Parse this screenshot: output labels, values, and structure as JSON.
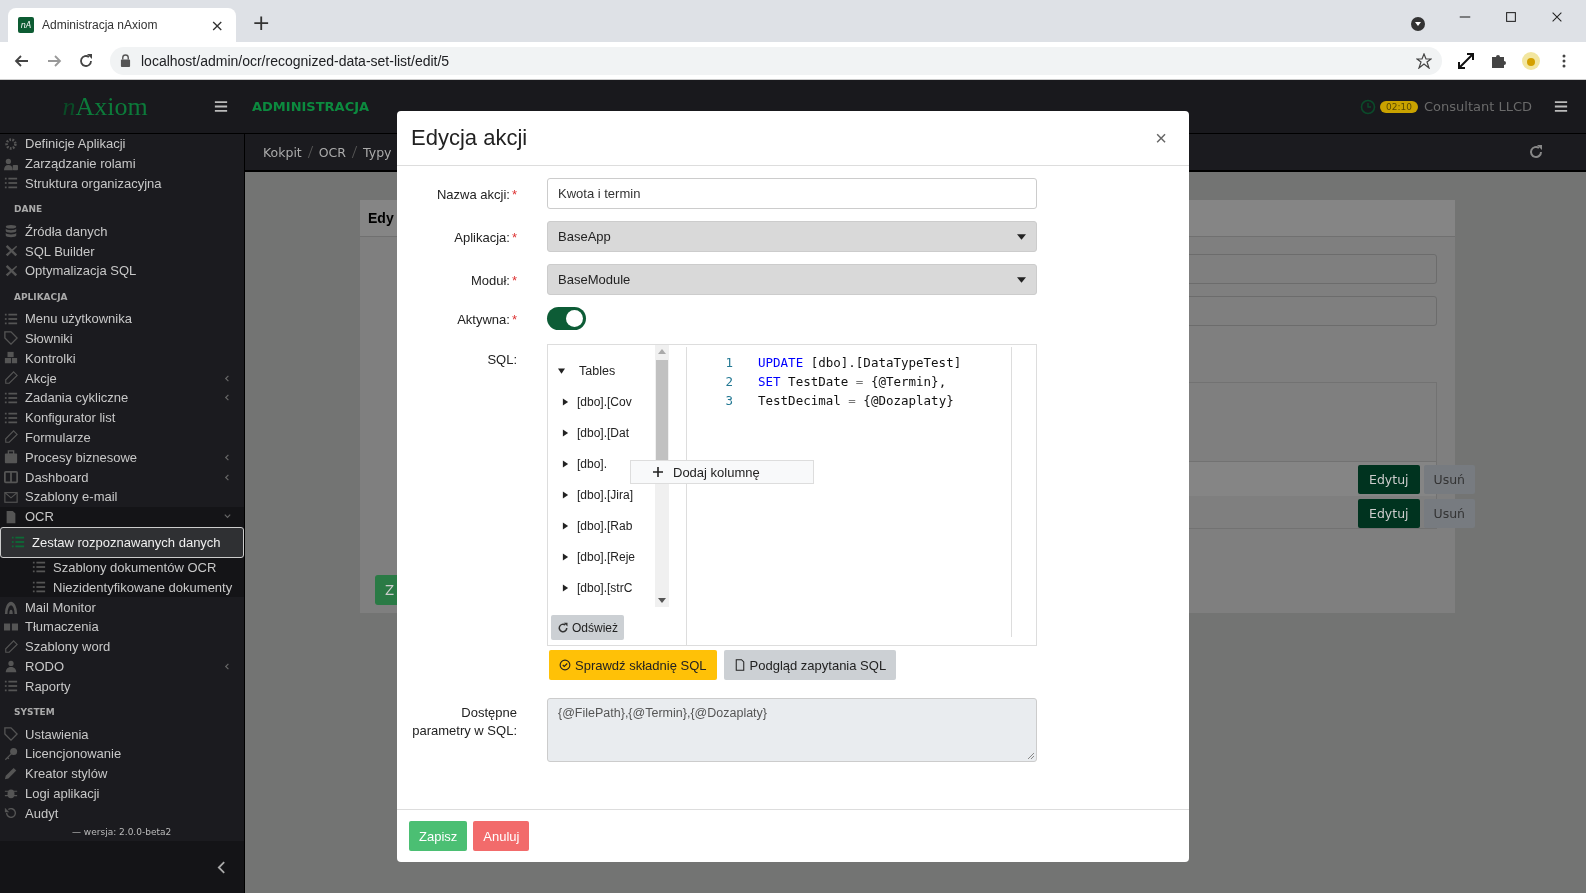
{
  "browser": {
    "favicon_text": "nA",
    "tab_title": "Administracja nAxiom",
    "tab_close": "×",
    "new_tab": "+",
    "url": "localhost/admin/ocr/recognized-data-set-list/edit/5"
  },
  "header": {
    "logo_mark": "n",
    "logo": "Axiom",
    "section": "ADMINISTRACJA",
    "timer": "02:10",
    "user": "Consultant LLCD"
  },
  "sidebar": {
    "sections": [
      {
        "items": [
          {
            "label": "Definicje Aplikacji"
          },
          {
            "label": "Zarządzanie rolami"
          },
          {
            "label": "Struktura organizacyjna"
          }
        ]
      },
      {
        "title": "DANE",
        "items": [
          {
            "label": "Źródła danych"
          },
          {
            "label": "SQL Builder"
          },
          {
            "label": "Optymalizacja SQL"
          }
        ]
      },
      {
        "title": "APLIKACJA",
        "items": [
          {
            "label": "Menu użytkownika"
          },
          {
            "label": "Słowniki"
          },
          {
            "label": "Kontrolki"
          },
          {
            "label": "Akcje",
            "expanded": false
          },
          {
            "label": "Zadania cykliczne",
            "expanded": false
          },
          {
            "label": "Konfigurator list"
          },
          {
            "label": "Formularze"
          },
          {
            "label": "Procesy biznesowe",
            "expanded": false
          },
          {
            "label": "Dashboard",
            "expanded": false
          },
          {
            "label": "Szablony e-mail"
          },
          {
            "label": "OCR",
            "expanded": true,
            "children": [
              {
                "label": "Zestaw rozpoznawanych danych",
                "selected": true
              },
              {
                "label": "Szablony dokumentów OCR",
                "selected": false
              },
              {
                "label": "Niezidentyfikowane dokumenty",
                "selected": false
              }
            ]
          },
          {
            "label": "Mail Monitor"
          },
          {
            "label": "Tłumaczenia"
          },
          {
            "label": "Szablony word"
          },
          {
            "label": "RODO",
            "expanded": false
          },
          {
            "label": "Raporty"
          }
        ]
      },
      {
        "title": "SYSTEM",
        "items": [
          {
            "label": "Ustawienia"
          },
          {
            "label": "Licencjonowanie"
          },
          {
            "label": "Kreator stylów"
          },
          {
            "label": "Logi aplikacji"
          },
          {
            "label": "Audyt"
          }
        ]
      }
    ],
    "version": "— wersja: 2.0.0-beta2"
  },
  "breadcrumb": [
    "Kokpit",
    "OCR",
    "Typy"
  ],
  "background_card": {
    "title": "Edy",
    "button": "Z",
    "rows": [
      {
        "edit": "Edytuj",
        "delete": "Usuń",
        "selected": true
      },
      {
        "edit": "Edytuj",
        "delete": "Usuń",
        "selected": false
      }
    ]
  },
  "modal": {
    "title": "Edycja akcji",
    "close": "×",
    "fields": [
      {
        "kind": "text",
        "label": "Nazwa akcji:",
        "required_mark": "*",
        "value": "Kwota i termin"
      },
      {
        "kind": "select",
        "label": "Aplikacja:",
        "required_mark": "*",
        "value": "BaseApp"
      },
      {
        "kind": "select",
        "label": "Moduł:",
        "required_mark": "*",
        "value": "BaseModule"
      },
      {
        "kind": "toggle",
        "label": "Aktywna:",
        "required_mark": "*",
        "on": true
      },
      {
        "kind": "sql",
        "label": "SQL:"
      },
      {
        "kind": "textarea",
        "label": "Dostępne parametry w SQL:",
        "value": "{@FilePath},{@Termin},{@Dozaplaty}"
      }
    ],
    "sql": {
      "tree": {
        "label": "Tables",
        "expanded": true,
        "children": [
          {
            "label": "[dbo].[Cov",
            "expanded": false
          },
          {
            "label": "[dbo].[Dat",
            "expanded": false
          },
          {
            "label": "[dbo].",
            "expanded": false
          },
          {
            "label": "[dbo].[Jira]",
            "expanded": false
          },
          {
            "label": "[dbo].[Rab",
            "expanded": false
          },
          {
            "label": "[dbo].[Reje",
            "expanded": false
          },
          {
            "label": "[dbo].[strC",
            "expanded": false
          }
        ]
      },
      "refresh": "Odśwież",
      "context_menu": "Dodaj kolumnę",
      "lines": [
        {
          "number": "1",
          "tokens": [
            {
              "kind": "keyword",
              "text": "UPDATE"
            },
            {
              "kind": "plain",
              "text": " [dbo].[DataTypeTest]"
            }
          ]
        },
        {
          "number": "2",
          "tokens": [
            {
              "kind": "keyword",
              "text": "SET"
            },
            {
              "kind": "plain",
              "text": " TestDate "
            },
            {
              "kind": "operator",
              "text": "="
            },
            {
              "kind": "plain",
              "text": " {@Termin},"
            }
          ]
        },
        {
          "number": "3",
          "tokens": [
            {
              "kind": "plain",
              "text": "TestDecimal "
            },
            {
              "kind": "operator",
              "text": "="
            },
            {
              "kind": "plain",
              "text": " {@Dozaplaty}"
            }
          ]
        }
      ],
      "check_button": "Sprawdź składnię SQL",
      "preview_button": "Podgląd zapytania SQL"
    },
    "buttons": [
      {
        "kind": "primary",
        "label": "Zapisz"
      },
      {
        "kind": "danger",
        "label": "Anuluj"
      }
    ]
  }
}
